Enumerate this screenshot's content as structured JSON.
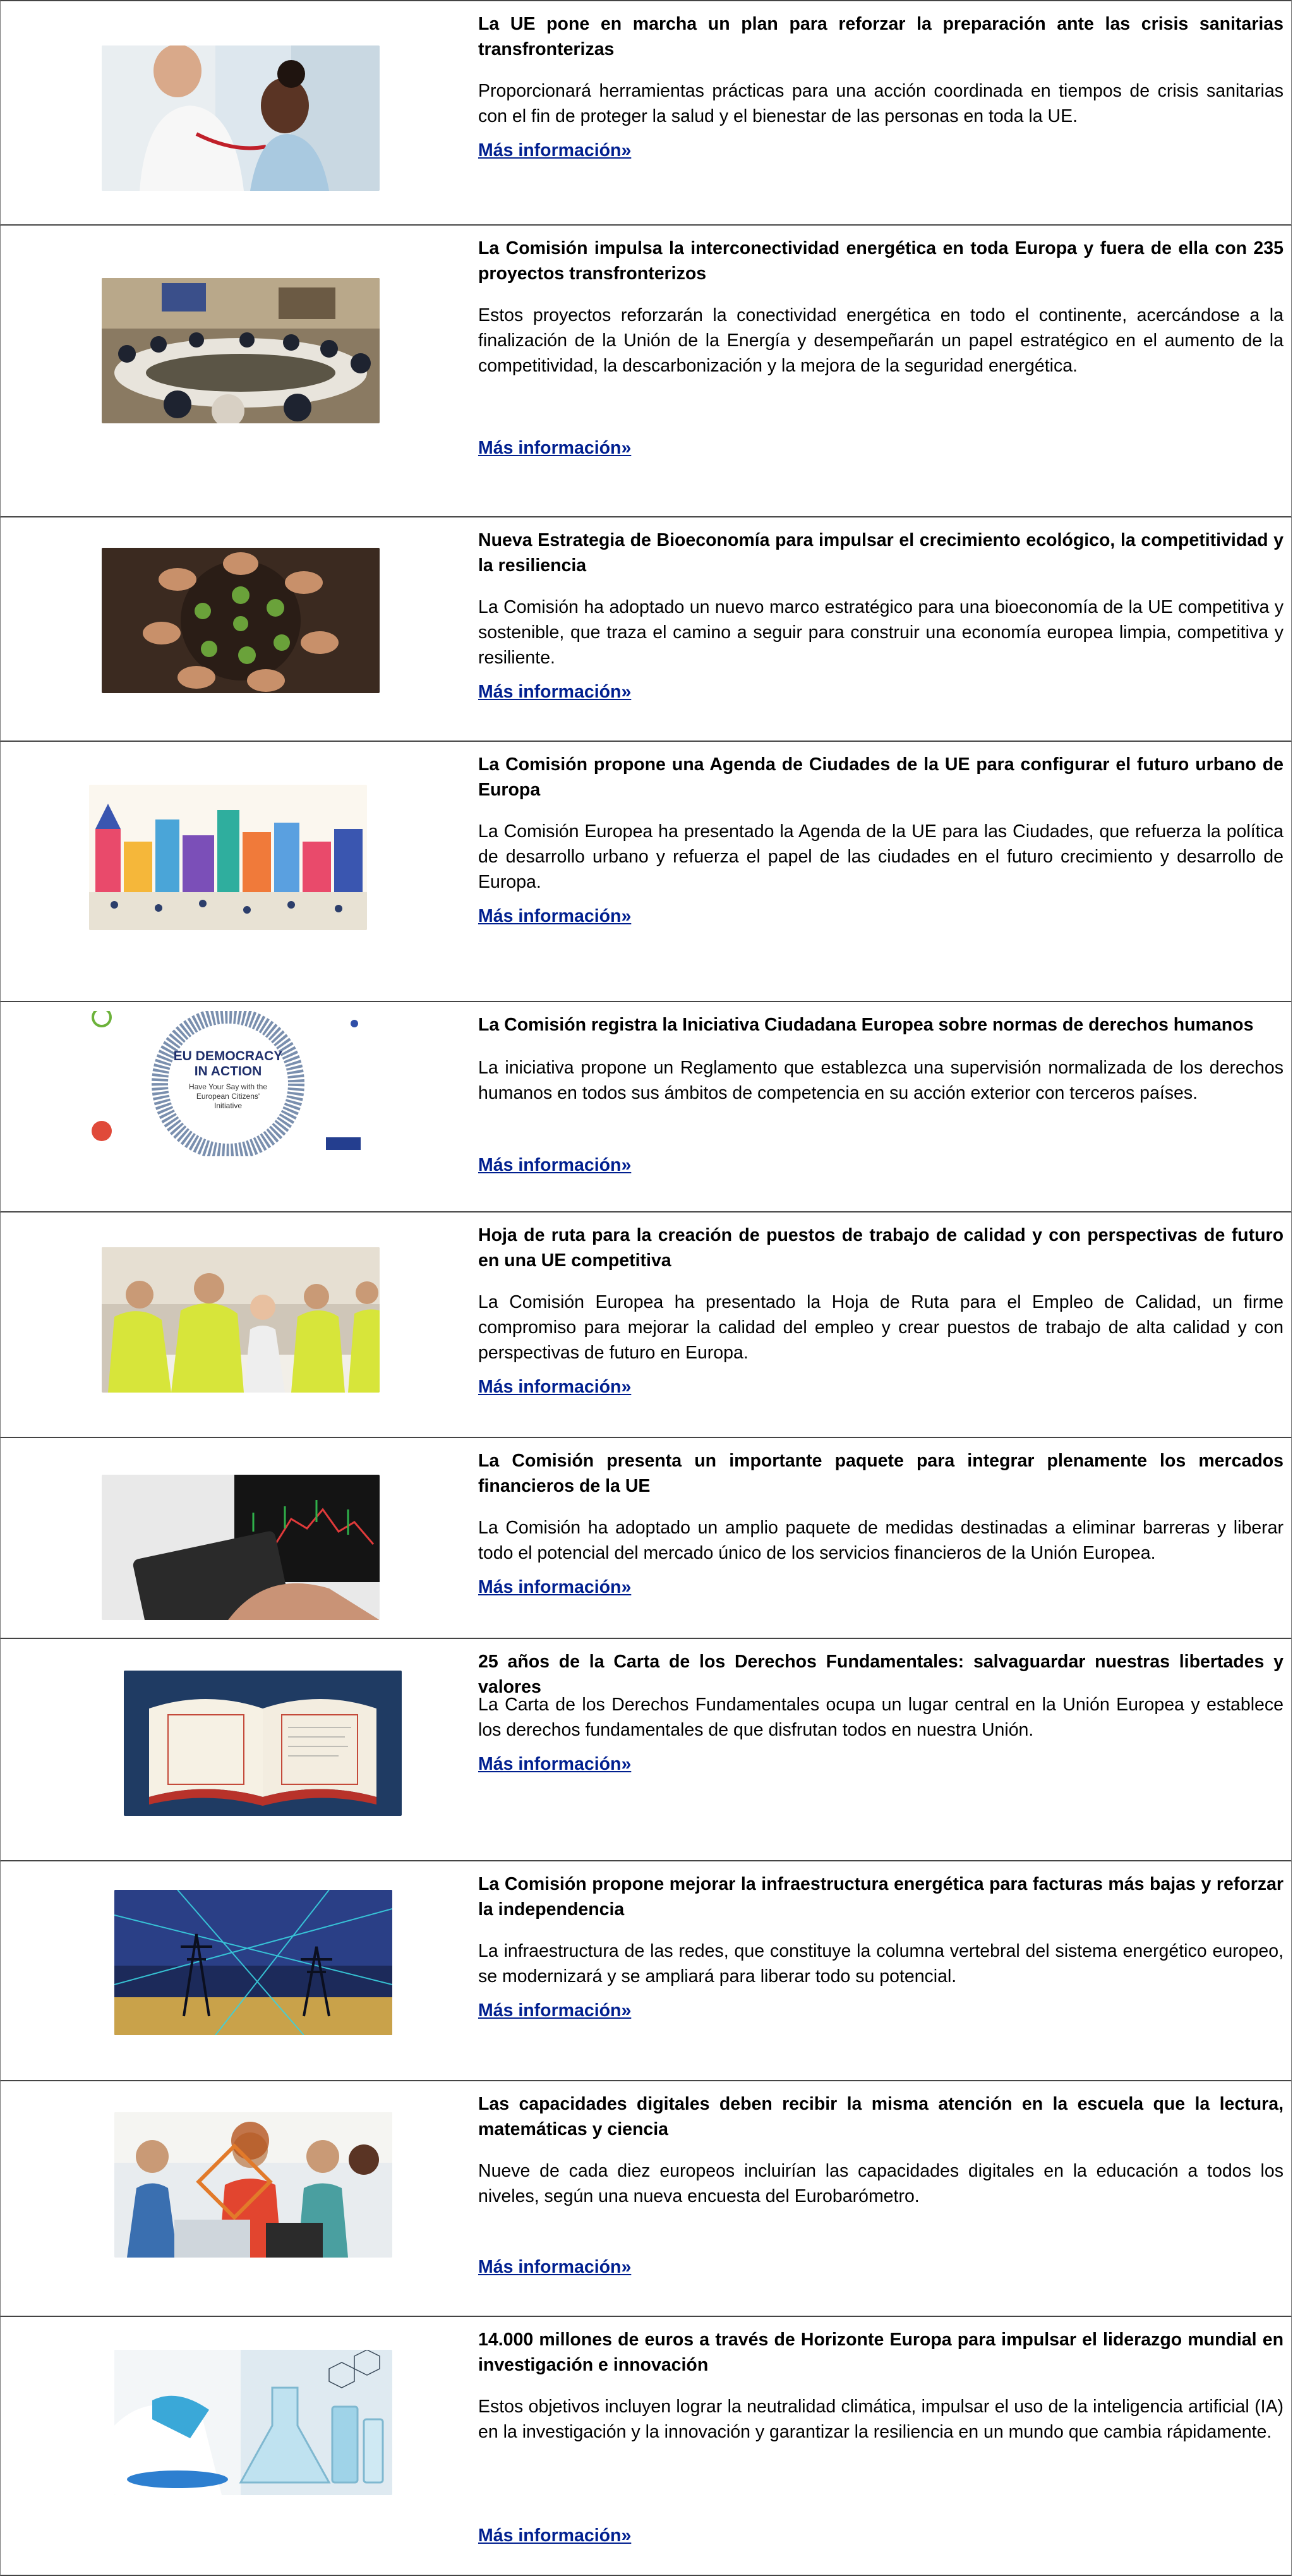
{
  "more_label": "Más información»",
  "items": [
    {
      "title": "La UE pone en marcha un plan para reforzar la preparación ante las crisis sanitarias transfronterizas",
      "description": "Proporcionará herramientas prácticas para una acción coordinada en tiempos de crisis sanitarias con el fin de proteger la salud y el bienestar de las personas en toda la UE.",
      "image": "doctor-child-photo"
    },
    {
      "title": "La Comisión impulsa la interconectividad energética en toda Europa y fuera de ella con 235 proyectos transfronterizos",
      "description": "Estos proyectos reforzarán la conectividad energética en todo el continente, acercándose a la finalización de la Unión de la Energía y desempeñarán un papel estratégico en el aumento de la competitividad, la descarbonización y la mejora de la seguridad energética.",
      "image": "meeting-room-photo"
    },
    {
      "title": "Nueva Estrategia de Bioeconomía para impulsar el crecimiento ecológico, la competitividad y la resiliencia",
      "description": "La Comisión ha adoptado un nuevo marco estratégico para una bioeconomía de la UE competitiva y sostenible, que traza el camino a seguir para construir una economía europea limpia, competitiva y resiliente.",
      "image": "hands-plants-photo"
    },
    {
      "title": "La Comisión propone una Agenda de Ciudades de la UE para configurar el futuro urbano de Europa",
      "description": "La Comisión Europea ha presentado la Agenda de la UE para las Ciudades, que refuerza la política de desarrollo urbano y refuerza el papel de las ciudades en el futuro crecimiento y desarrollo de Europa.",
      "image": "city-illustration"
    },
    {
      "title": "La Comisión registra la Iniciativa Ciudadana Europea sobre normas de derechos humanos",
      "description": "La iniciativa propone un Reglamento que establezca una supervisión normalizada de los derechos humanos en todos sus ámbitos de competencia en su acción exterior con terceros países.",
      "image": "eu-democracy-graphic",
      "graphic_text": {
        "line1": "EU DEMOCRACY",
        "line2": "IN ACTION",
        "line3": "Have Your Say with the",
        "line4": "European Citizens'",
        "line5": "Initiative"
      }
    },
    {
      "title": "Hoja de ruta para la creación de puestos de trabajo de calidad y con perspectivas de futuro en una UE competitiva",
      "description": "La Comisión Europea ha presentado la Hoja de Ruta para el Empleo de Calidad, un firme compromiso para mejorar la calidad del empleo y crear puestos de trabajo de alta calidad y con perspectivas de futuro en Europa.",
      "image": "workers-photo"
    },
    {
      "title": "La Comisión presenta un importante paquete para integrar plenamente los mercados financieros de la UE",
      "description": "La Comisión ha adoptado un amplio paquete de medidas destinadas a eliminar barreras y liberar todo el potencial del mercado único de los servicios financieros de la Unión Europea.",
      "image": "finance-tablet-photo"
    },
    {
      "title": "25 años de la Carta de los Derechos Fundamentales: salvaguardar nuestras libertades y valores",
      "description": "La Carta de los Derechos Fundamentales ocupa un lugar central en la Unión Europea y establece los derechos fundamentales de que disfrutan todos en nuestra Unión.",
      "image": "open-book-photo"
    },
    {
      "title": "La Comisión propone mejorar la infraestructura energética para facturas más bajas y reforzar la independencia",
      "description": "La infraestructura de las redes, que constituye la columna vertebral del sistema energético europeo, se modernizará y se ampliará para liberar todo su potencial.",
      "image": "power-grid-photo"
    },
    {
      "title": "Las capacidades digitales deben recibir la misma atención en la escuela que la lectura, matemáticas y ciencia",
      "description": "Nueve de cada diez europeos incluirían las capacidades digitales en la educación a todos los niveles, según una nueva encuesta del Eurobarómetro.",
      "image": "students-laptop-photo"
    },
    {
      "title": "14.000 millones de euros a través de Horizonte Europa para impulsar el liderazgo mundial en investigación e innovación",
      "description": "Estos objetivos incluyen lograr la neutralidad climática, impulsar el uso de la inteligencia artificial (IA) en la investigación y la innovación y garantizar la resiliencia en un mundo que cambia rápidamente.",
      "image": "laboratory-photo"
    }
  ]
}
